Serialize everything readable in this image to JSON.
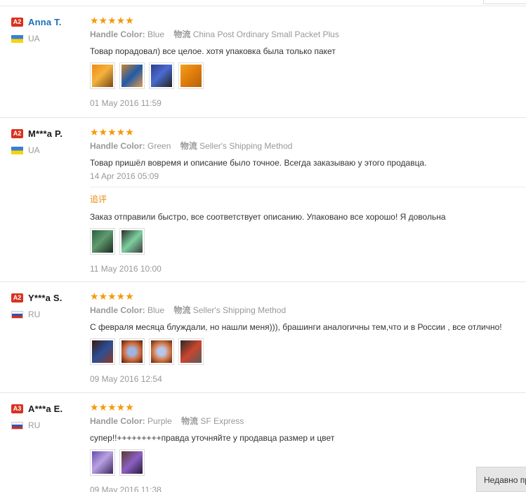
{
  "labels": {
    "color_label": "Handle Color:",
    "shipping_label": "物流",
    "additional_label": "追评",
    "stars": "★★★★★"
  },
  "reviews": [
    {
      "level": "A2",
      "name": "Anna T.",
      "country": "UA",
      "color": "Blue",
      "shipping": "China Post Ordinary Small Packet Plus",
      "text": "Товар порадовал) все целое. хотя упаковка была только пакет",
      "date": "01 May 2016 11:59"
    },
    {
      "level": "A2",
      "name": "M***a P.",
      "country": "UA",
      "color": "Green",
      "shipping": "Seller's Shipping Method",
      "text": "Товар пришёл вовремя и описание было точное. Всегда заказываю у этого продавца.",
      "date": "14 Apr 2016 05:09",
      "additional": {
        "text": "Заказ отправили быстро, все соответствует описанию. Упаковано все хорошо! Я довольна",
        "date": "11 May 2016 10:00"
      }
    },
    {
      "level": "A2",
      "name": "Y***a S.",
      "country": "RU",
      "color": "Blue",
      "shipping": "Seller's Shipping Method",
      "text": "С февраля месяца блуждали, но нашли меня))), брашинги аналогичны тем,что и в России , все отлично!",
      "date": "09 May 2016 12:54"
    },
    {
      "level": "A3",
      "name": "A***a E.",
      "country": "RU",
      "color": "Purple",
      "shipping": "SF Express",
      "text": "супер!!+++++++++правда уточняйте у продавца размер и цвет",
      "date": "09 May 2016 11:38"
    }
  ],
  "float_button": "Недавно просмотренные"
}
